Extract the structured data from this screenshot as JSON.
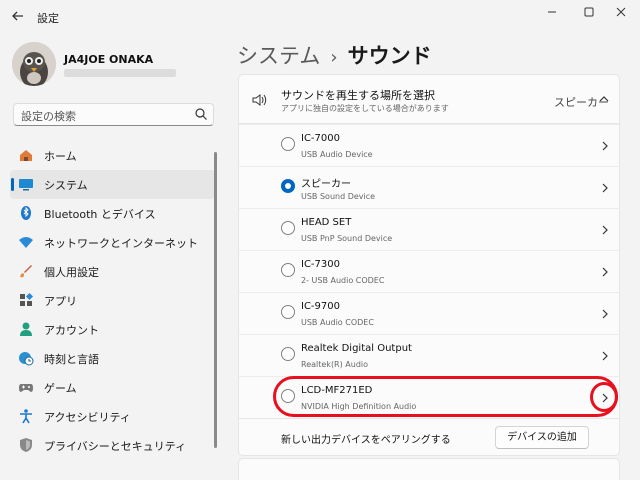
{
  "window": {
    "title": "設定",
    "back_icon": "arrow-left-icon",
    "controls": [
      "minimize",
      "maximize",
      "close"
    ]
  },
  "profile": {
    "name": "JA4JOE ONAKA"
  },
  "search": {
    "placeholder": "設定の検索"
  },
  "sidebar": {
    "items": [
      {
        "label": "ホーム",
        "icon": "home-icon",
        "active": false
      },
      {
        "label": "システム",
        "icon": "monitor-icon",
        "active": true
      },
      {
        "label": "Bluetooth とデバイス",
        "icon": "bluetooth-icon",
        "active": false
      },
      {
        "label": "ネットワークとインターネット",
        "icon": "wifi-icon",
        "active": false
      },
      {
        "label": "個人用設定",
        "icon": "brush-icon",
        "active": false
      },
      {
        "label": "アプリ",
        "icon": "apps-icon",
        "active": false
      },
      {
        "label": "アカウント",
        "icon": "person-icon",
        "active": false
      },
      {
        "label": "時刻と言語",
        "icon": "globe-clock-icon",
        "active": false
      },
      {
        "label": "ゲーム",
        "icon": "gamepad-icon",
        "active": false
      },
      {
        "label": "アクセシビリティ",
        "icon": "accessibility-icon",
        "active": false
      },
      {
        "label": "プライバシーとセキュリティ",
        "icon": "shield-icon",
        "active": false
      }
    ]
  },
  "breadcrumb": {
    "parent": "システム",
    "separator": "›",
    "current": "サウンド"
  },
  "output_section": {
    "title": "サウンドを再生する場所を選択",
    "description": "アプリに独自の設定をしている場合があります",
    "selected": "スピーカー"
  },
  "devices": [
    {
      "name": "IC-7000",
      "type": "USB Audio Device",
      "checked": false
    },
    {
      "name": "スピーカー",
      "type": "USB Sound Device",
      "checked": true
    },
    {
      "name": "HEAD SET",
      "type": "USB PnP Sound Device",
      "checked": false
    },
    {
      "name": "IC-7300",
      "type": "2- USB Audio CODEC",
      "checked": false
    },
    {
      "name": "IC-9700",
      "type": "USB Audio CODEC",
      "checked": false
    },
    {
      "name": "Realtek Digital Output",
      "type": "Realtek(R) Audio",
      "checked": false
    },
    {
      "name": "LCD-MF271ED",
      "type": "NVIDIA High Definition Audio",
      "checked": false
    }
  ],
  "pair": {
    "text": "新しい出力デバイスをペアリングする",
    "button": "デバイスの追加"
  },
  "colors": {
    "accent": "#0067c0",
    "highlight": "#e8101e",
    "background": "#f3f3f3"
  }
}
